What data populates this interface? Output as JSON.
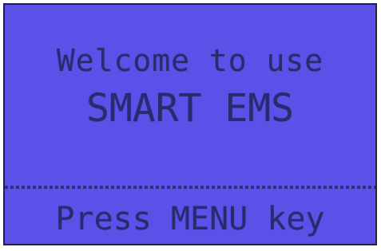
{
  "screen": {
    "welcome_line": "Welcome to use",
    "product_name": "SMART EMS",
    "prompt_line": "Press MENU key"
  },
  "colors": {
    "lcd_background": "#5a52e8",
    "lcd_pixels": "#2c2a6e"
  }
}
